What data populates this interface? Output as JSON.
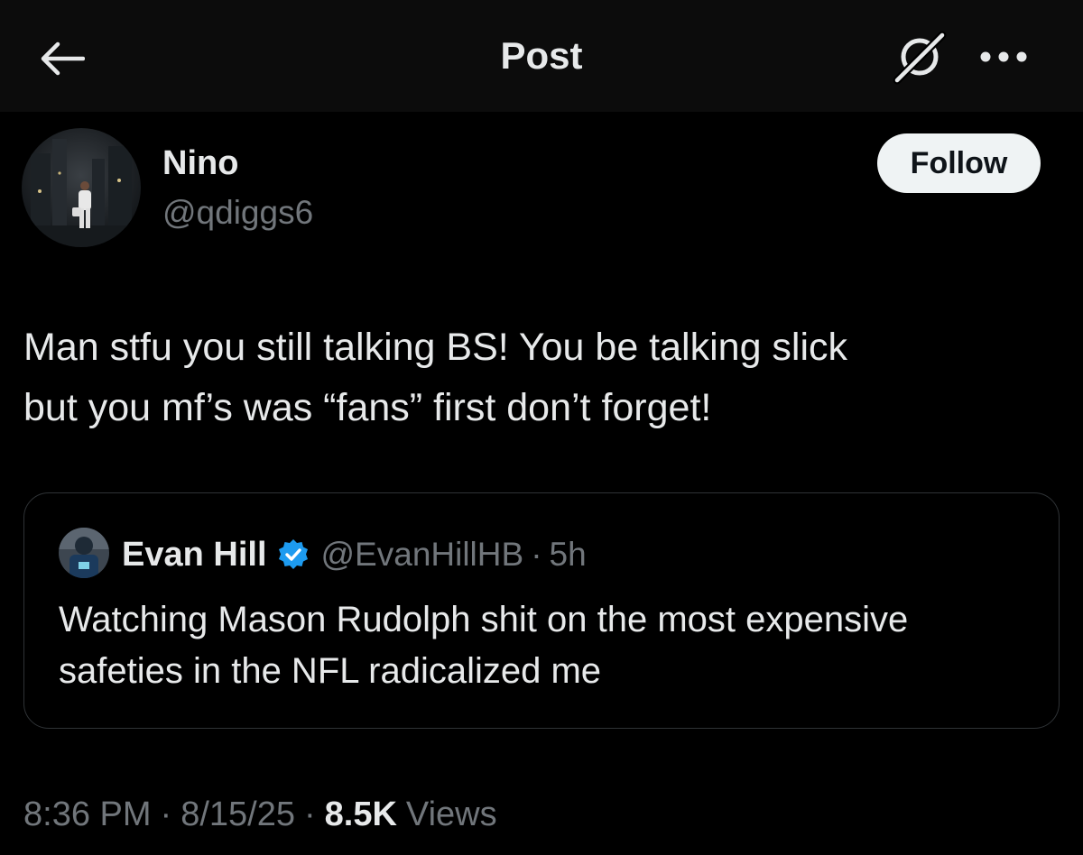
{
  "header": {
    "title": "Post",
    "back_icon": "arrow-left-icon",
    "grok_icon": "grok-icon",
    "more_icon": "more-horizontal-icon"
  },
  "author": {
    "display_name": "Nino",
    "handle": "@qdiggs6",
    "follow_label": "Follow"
  },
  "post": {
    "text_line1": "Man stfu you still talking BS! You be talking slick",
    "text_line2": "but you mf’s was “fans” first don’t forget!"
  },
  "quote": {
    "name": "Evan Hill",
    "verified_icon": "verified-badge-icon",
    "handle": "@EvanHillHB",
    "separator": "·",
    "time": "5h",
    "text_line1": "Watching Mason Rudolph shit on the most expensive",
    "text_line2": "safeties in the NFL radicalized me"
  },
  "meta": {
    "time": "8:36 PM",
    "separator": "·",
    "date": "8/15/25",
    "views_count": "8.5K",
    "views_label": "Views"
  },
  "colors": {
    "background": "#000000",
    "topbar": "#0c0c0c",
    "primary_text": "#e7e9ea",
    "secondary_text": "#71767b",
    "border": "#2f3336",
    "verified": "#1d9bf0",
    "follow_button": "#eff3f4"
  }
}
